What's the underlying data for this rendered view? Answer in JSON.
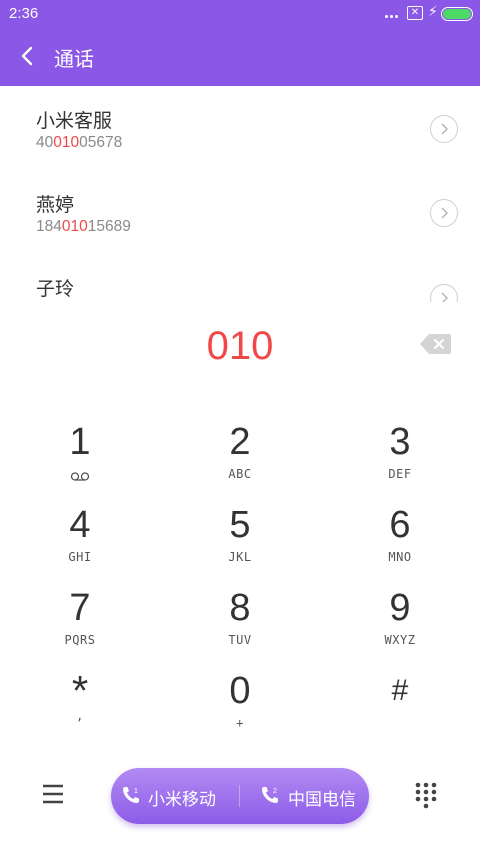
{
  "status_bar": {
    "time": "2:36",
    "battery_color": "#4cd964",
    "sim_icon": "sim-no-service-icon"
  },
  "app_bar": {
    "title": "通话",
    "color": "#8b57e6"
  },
  "results": [
    {
      "name": "小米客服",
      "number_pre": "40",
      "number_match": "010",
      "number_post": "05678"
    },
    {
      "name": "燕婷",
      "number_pre": "184",
      "number_match": "010",
      "number_post": "15689"
    },
    {
      "name": "子玲",
      "number_pre": "",
      "number_match": "",
      "number_post": ""
    }
  ],
  "dial": {
    "value": "010",
    "highlight_color": "#f04848"
  },
  "keypad": [
    {
      "digit": "1",
      "letters": "",
      "sub_icon": "voicemail-icon"
    },
    {
      "digit": "2",
      "letters": "ABC"
    },
    {
      "digit": "3",
      "letters": "DEF"
    },
    {
      "digit": "4",
      "letters": "GHI"
    },
    {
      "digit": "5",
      "letters": "JKL"
    },
    {
      "digit": "6",
      "letters": "MNO"
    },
    {
      "digit": "7",
      "letters": "PQRS"
    },
    {
      "digit": "8",
      "letters": "TUV"
    },
    {
      "digit": "9",
      "letters": "WXYZ"
    },
    {
      "digit": "*",
      "letters": ","
    },
    {
      "digit": "0",
      "letters": "+"
    },
    {
      "digit": "#",
      "letters": ""
    }
  ],
  "bottom_bar": {
    "sim1_label": "小米移动",
    "sim2_label": "中国电信",
    "pill_color": "#8c5ce8"
  }
}
